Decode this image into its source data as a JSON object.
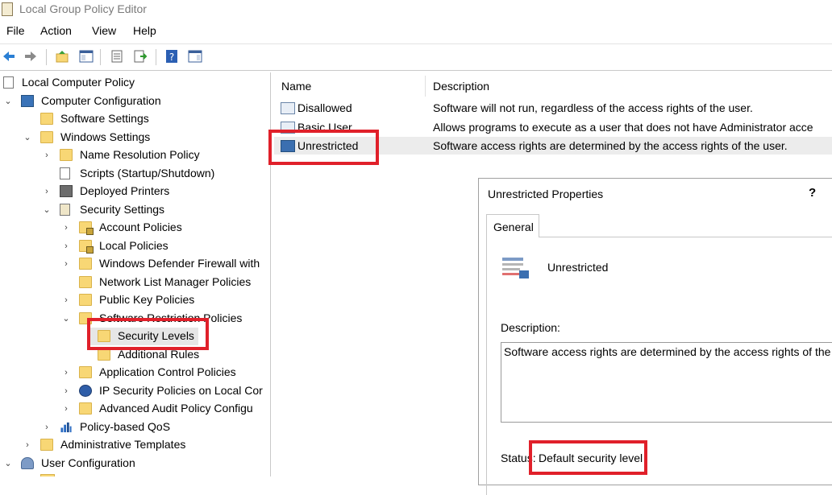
{
  "window": {
    "title": "Local Group Policy Editor"
  },
  "menu": [
    "File",
    "Action",
    "View",
    "Help"
  ],
  "tree": {
    "items": [
      {
        "label": "Local Computer Policy"
      },
      {
        "label": "Computer Configuration"
      },
      {
        "label": "Software Settings"
      },
      {
        "label": "Windows Settings"
      },
      {
        "label": "Name Resolution Policy"
      },
      {
        "label": "Scripts (Startup/Shutdown)"
      },
      {
        "label": "Deployed Printers"
      },
      {
        "label": "Security Settings"
      },
      {
        "label": "Account Policies"
      },
      {
        "label": "Local Policies"
      },
      {
        "label": "Windows Defender Firewall with"
      },
      {
        "label": "Network List Manager Policies"
      },
      {
        "label": "Public Key Policies"
      },
      {
        "label": "Software Restriction Policies"
      },
      {
        "label": "Security Levels"
      },
      {
        "label": "Additional Rules"
      },
      {
        "label": "Application Control Policies"
      },
      {
        "label": "IP Security Policies on Local Cor"
      },
      {
        "label": "Advanced Audit Policy Configu"
      },
      {
        "label": "Policy-based QoS"
      },
      {
        "label": "Administrative Templates"
      },
      {
        "label": "User Configuration"
      }
    ]
  },
  "list": {
    "headers": {
      "name": "Name",
      "description": "Description"
    },
    "rows": [
      {
        "name": "Disallowed",
        "description": "Software will not run, regardless of the access rights of the user."
      },
      {
        "name": "Basic User",
        "description": "Allows programs to execute as a user that does not have Administrator acce"
      },
      {
        "name": "Unrestricted",
        "description": "Software access rights are determined by the access rights of the user."
      }
    ]
  },
  "dialog": {
    "title": "Unrestricted Properties",
    "help": "?",
    "tab": "General",
    "name": "Unrestricted",
    "description_label": "Description:",
    "description_value": "Software access rights are determined by the access rights of the user.",
    "status_label": "Status:",
    "status_value": "Default security level"
  },
  "colors": {
    "highlight": "#e0202a",
    "folder": "#f8d775",
    "selection": "#ececec"
  }
}
